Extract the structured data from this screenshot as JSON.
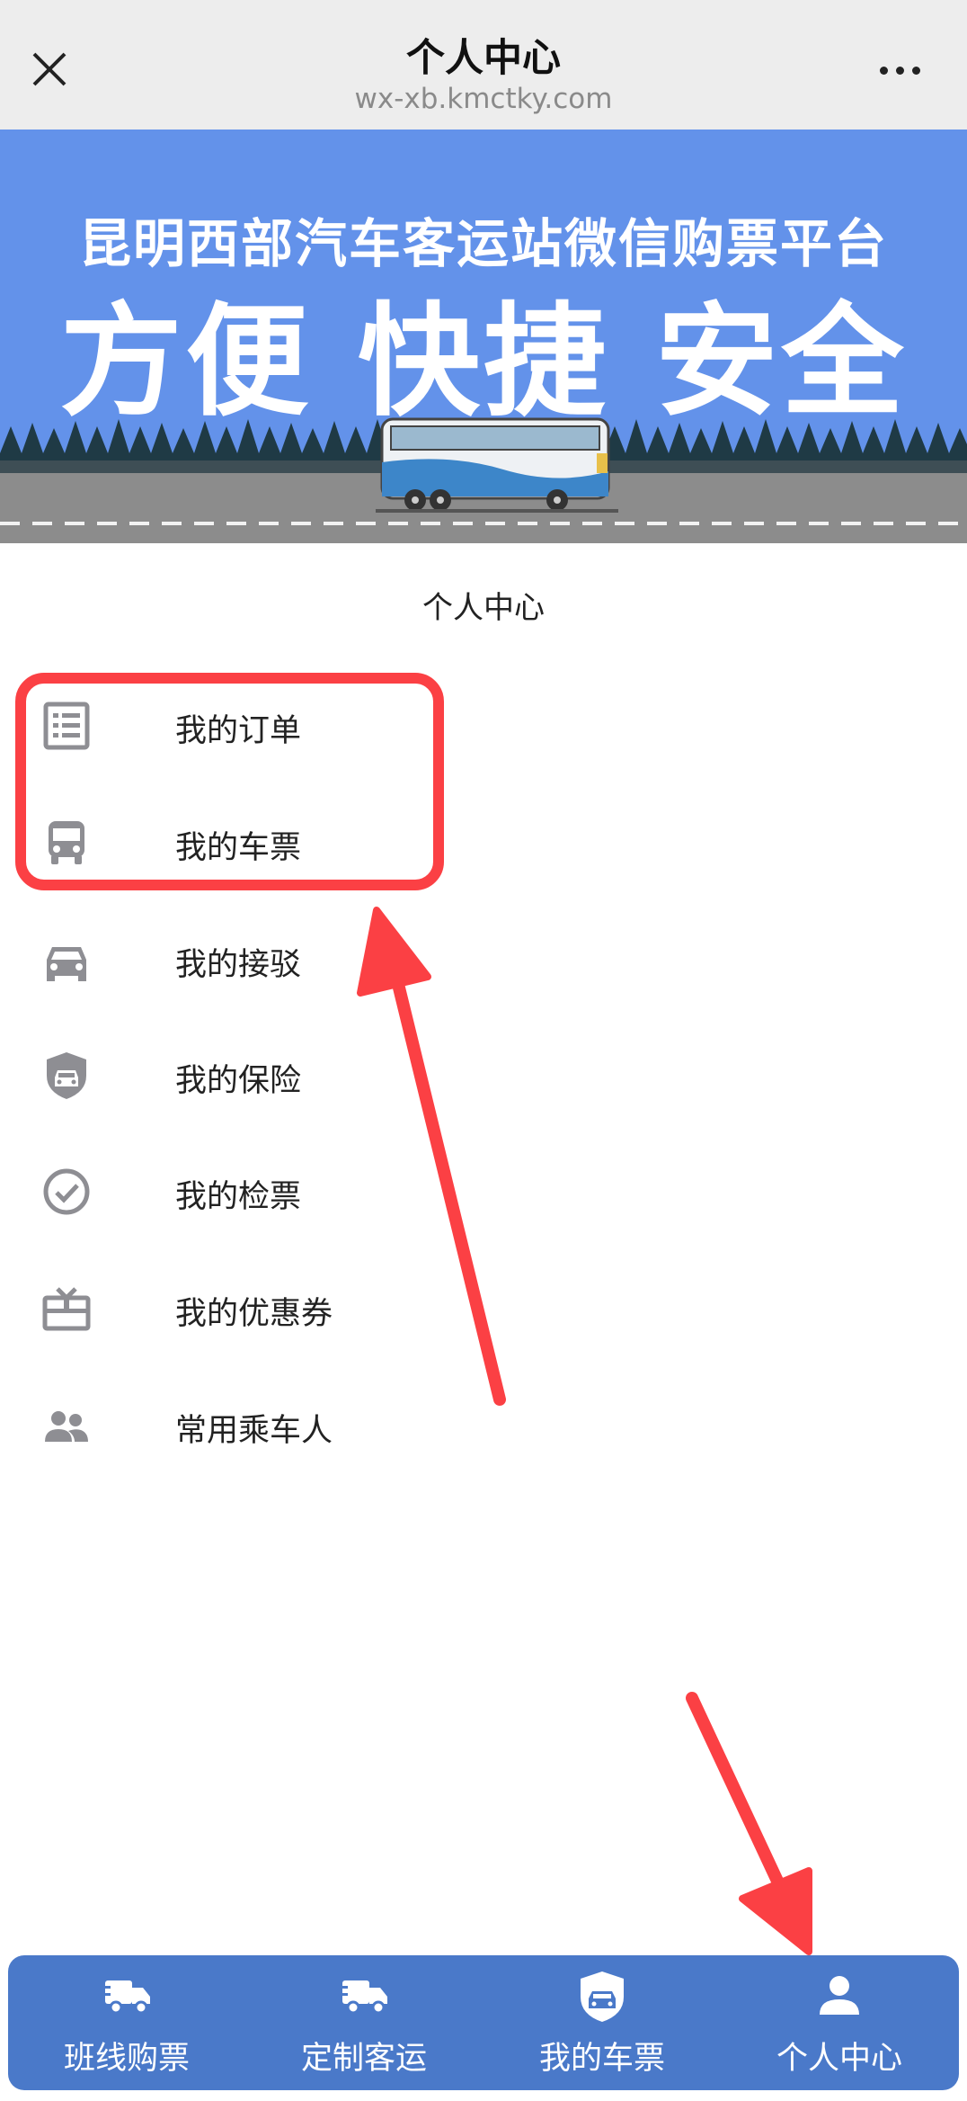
{
  "browser": {
    "title": "个人中心",
    "url": "wx-xb.kmctky.com"
  },
  "banner": {
    "line1": "昆明西部汽车客运站微信购票平台",
    "line2": "方便 快捷 安全"
  },
  "section_title": "个人中心",
  "menu": [
    {
      "label": "我的订单",
      "icon": "order-list-icon"
    },
    {
      "label": "我的车票",
      "icon": "bus-icon"
    },
    {
      "label": "我的接驳",
      "icon": "car-icon"
    },
    {
      "label": "我的保险",
      "icon": "shield-car-icon"
    },
    {
      "label": "我的检票",
      "icon": "check-circle-icon"
    },
    {
      "label": "我的优惠券",
      "icon": "coupon-icon"
    },
    {
      "label": "常用乘车人",
      "icon": "people-icon"
    }
  ],
  "tabs": [
    {
      "label": "班线购票",
      "icon": "truck-icon"
    },
    {
      "label": "定制客运",
      "icon": "truck-icon"
    },
    {
      "label": "我的车票",
      "icon": "shield-car-icon"
    },
    {
      "label": "个人中心",
      "icon": "person-icon"
    }
  ],
  "colors": {
    "banner_bg": "#6392ea",
    "tabbar_bg": "#4a79c9",
    "annotation": "#fb4044",
    "icon_gray": "#8e8e93"
  }
}
